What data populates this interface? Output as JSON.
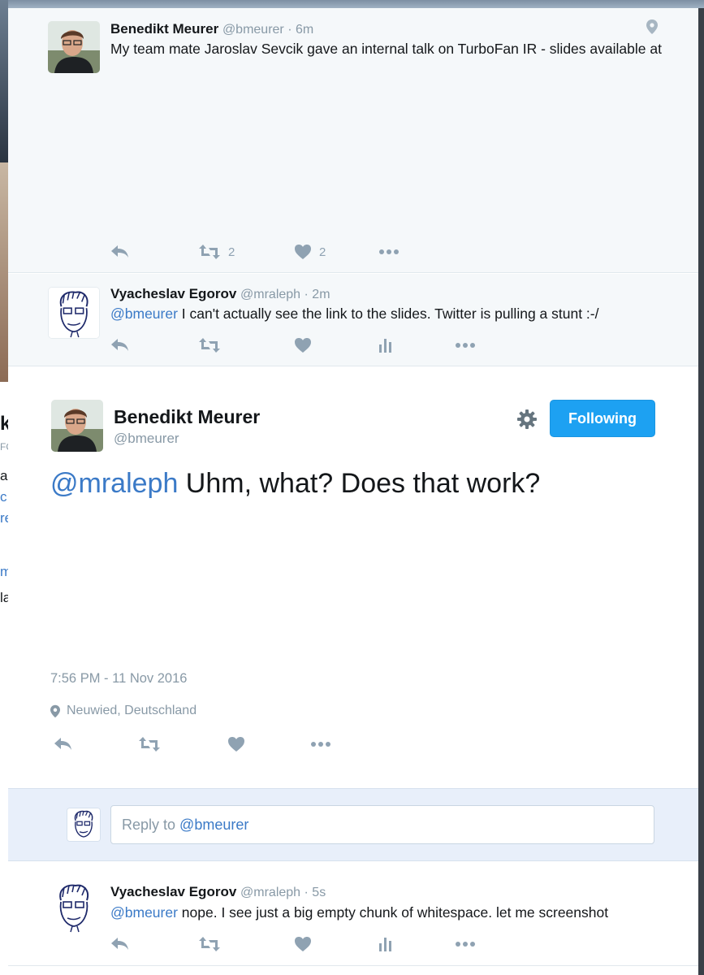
{
  "thread": [
    {
      "name": "Benedikt Meurer",
      "handle": "@bmeurer",
      "time": "6m",
      "text": "My team mate Jaroslav Sevcik gave an internal talk on TurboFan IR - slides available at",
      "retweets": "2",
      "likes": "2"
    },
    {
      "name": "Vyacheslav Egorov",
      "handle": "@mraleph",
      "time": "2m",
      "mention": "@bmeurer",
      "text": " I can't actually see the link to the slides. Twitter is pulling a stunt :-/"
    }
  ],
  "permalink": {
    "name": "Benedikt Meurer",
    "handle": "@bmeurer",
    "follow_label": "Following",
    "mention": "@mraleph",
    "text": " Uhm, what? Does that work?",
    "timestamp": "7:56 PM - 11 Nov 2016",
    "location": "Neuwied, Deutschland"
  },
  "reply": {
    "placeholder_prefix": "Reply to ",
    "placeholder_mention": "@bmeurer"
  },
  "replies": [
    {
      "name": "Vyacheslav Egorov",
      "handle": "@mraleph",
      "time": "5s",
      "mention": "@bmeurer",
      "text": " nope. I see just a big empty chunk of whitespace. let me screenshot"
    }
  ],
  "background_page": {
    "fragments": [
      "k",
      "FO",
      "a",
      "c",
      "re",
      "m",
      "la"
    ]
  },
  "colors": {
    "accent": "#1da1f2",
    "link": "#3b7ac7",
    "muted": "#8899a6",
    "reply_bar": "#e8effa"
  },
  "separator": " · "
}
